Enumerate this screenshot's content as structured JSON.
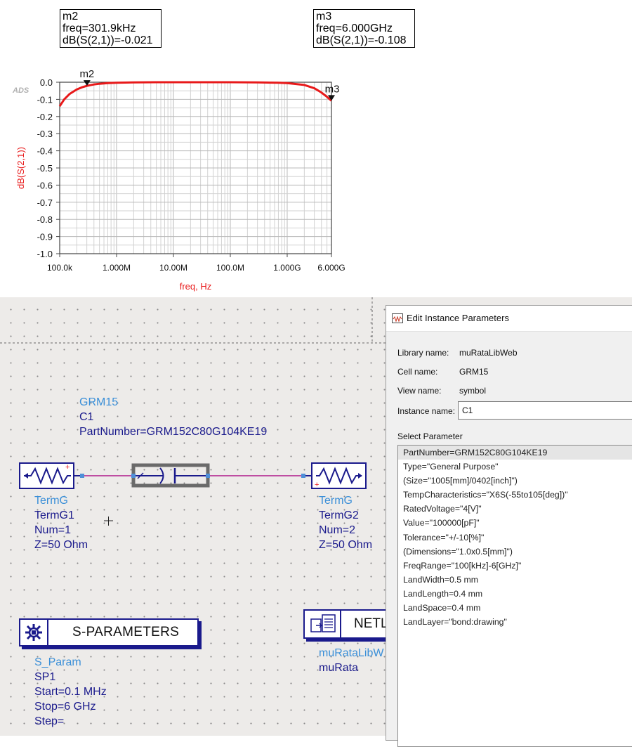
{
  "markers": [
    {
      "name": "m2",
      "line1": "freq=301.9kHz",
      "line2": "dB(S(2,1))=-0.021"
    },
    {
      "name": "m3",
      "line1": "freq=6.000GHz",
      "line2": "dB(S(2,1))=-0.108"
    }
  ],
  "chart_data": {
    "type": "line",
    "xlabel": "freq, Hz",
    "ylabel": "dB(S(2,1))",
    "corner_label": "ADS",
    "x_scale": "log",
    "xlim": [
      100000,
      6000000000
    ],
    "ylim": [
      -1.0,
      0.0
    ],
    "grid": true,
    "x_tick_labels": [
      "100.0k",
      "1.000M",
      "10.00M",
      "100.0M",
      "1.000G",
      "6.000G"
    ],
    "y_tick_labels": [
      "0.0",
      "-0.1",
      "-0.2",
      "-0.3",
      "-0.4",
      "-0.5",
      "-0.6",
      "-0.7",
      "-0.8",
      "-0.9",
      "-1.0"
    ],
    "series": [
      {
        "color": "#e8191a",
        "x": [
          100000,
          120000,
          150000,
          200000,
          250000,
          301900,
          400000,
          500000,
          700000,
          1000000,
          2000000,
          5000000,
          10000000,
          30000000,
          100000000,
          300000000,
          700000000,
          1000000000,
          2000000000,
          3000000000,
          4000000000,
          5000000000,
          6000000000
        ],
        "y": [
          -0.14,
          -0.1,
          -0.068,
          -0.042,
          -0.029,
          -0.021,
          -0.013,
          -0.009,
          -0.005,
          -0.003,
          -0.001,
          0.0,
          0.0,
          0.0,
          0.0,
          -0.001,
          -0.003,
          -0.005,
          -0.016,
          -0.035,
          -0.06,
          -0.085,
          -0.108
        ]
      }
    ],
    "marker_points": [
      {
        "label": "m2",
        "x": 301900,
        "y": -0.021
      },
      {
        "label": "m3",
        "x": 6000000000,
        "y": -0.108
      }
    ]
  },
  "schematic": {
    "cap": {
      "lib": "GRM15",
      "inst": "C1",
      "part": "PartNumber=GRM152C80G104KE19"
    },
    "term1": {
      "type": "TermG",
      "inst": "TermG1",
      "num": "Num=1",
      "z": "Z=50 Ohm"
    },
    "term2": {
      "type": "TermG",
      "inst": "TermG2",
      "num": "Num=2",
      "z": "Z=50 Ohm"
    },
    "sparam": {
      "title": "S-PARAMETERS",
      "type": "S_Param",
      "inst": "SP1",
      "start": "Start=0.1 MHz",
      "stop": "Stop=6 GHz",
      "step": "Step="
    },
    "netlist": {
      "title": "NETL",
      "lib": "muRataLibW",
      "inst": "muRata"
    }
  },
  "dialog": {
    "title": "Edit Instance Parameters",
    "library_label": "Library name:",
    "library_value": "muRataLibWeb",
    "cell_label": "Cell name:",
    "cell_value": "GRM15",
    "view_label": "View name:",
    "view_value": "symbol",
    "instance_label": "Instance name:",
    "instance_value": "C1",
    "select_label": "Select Parameter",
    "parameters": [
      "PartNumber=GRM152C80G104KE19",
      "Type=\"General Purpose\"",
      "(Size=\"1005[mm]/0402[inch]\")",
      "TempCharacteristics=\"X6S(-55to105[deg])\"",
      "RatedVoltage=\"4[V]\"",
      "Value=\"100000[pF]\"",
      "Tolerance=\"+/-10[%]\"",
      "(Dimensions=\"1.0x0.5[mm]\")",
      "FreqRange=\"100[kHz]-6[GHz]\"",
      "LandWidth=0.5 mm",
      "LandLength=0.4 mm",
      "LandSpace=0.4 mm",
      "LandLayer=\"bond:drawing\""
    ]
  }
}
